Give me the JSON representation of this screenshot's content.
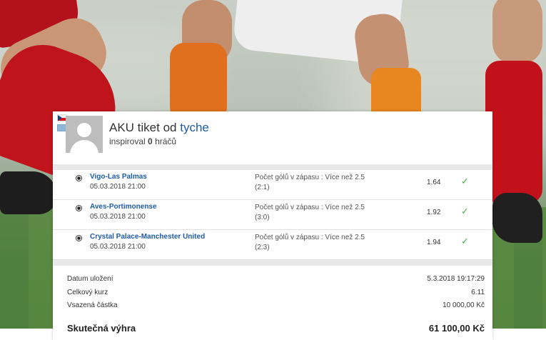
{
  "ticket": {
    "title_prefix": "AKU tiket od",
    "user": "tyche",
    "inspired_prefix": "inspiroval",
    "inspired_count": "0",
    "inspired_suffix": "hráčů",
    "flag": "czech-flag",
    "status_icon": "card-icon"
  },
  "bets": [
    {
      "match": "Vigo-Las Palmas",
      "date": "05.03.2018 21:00",
      "bet": "Počet gólů v zápasu : Více než 2.5",
      "score": "(2:1)",
      "odd": "1.64",
      "status": "check-icon",
      "status_color": "#4cae4c"
    },
    {
      "match": "Aves-Portimonense",
      "date": "05.03.2018 21:00",
      "bet": "Počet gólů v zápasu : Více než 2.5",
      "score": "(3:0)",
      "odd": "1.92",
      "status": "check-icon",
      "status_color": "#4cae4c"
    },
    {
      "match": "Crystal Palace-Manchester United",
      "date": "05.03.2018 21:00",
      "bet": "Počet gólů v zápasu : Více než 2.5",
      "score": "(2:3)",
      "odd": "1.94",
      "status": "check-icon",
      "status_color": "#4cae4c"
    }
  ],
  "summary": {
    "saved_label": "Datum uložení",
    "saved_value": "5.3.2018 19:17:29",
    "total_odds_label": "Celkový kurz",
    "total_odds_value": "6.11",
    "stake_label": "Vsazená částka",
    "stake_value": "10 000,00 Kč",
    "win_label": "Skutečná výhra",
    "win_value": "61 100,00 Kč"
  },
  "colors": {
    "link": "#1e5ba8",
    "success": "#4cae4c",
    "separator": "#e8e8e8"
  }
}
